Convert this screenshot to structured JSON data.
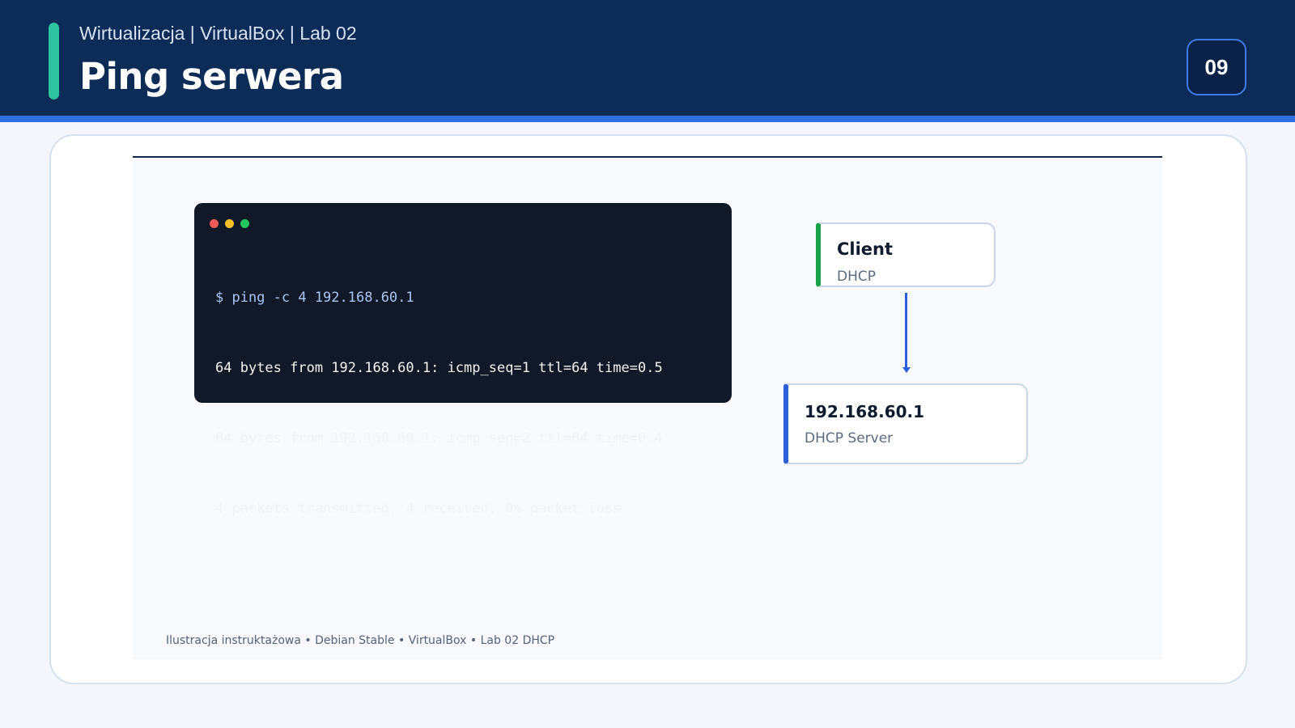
{
  "header": {
    "subtitle": "Wirtualizacja | VirtualBox | Lab 02",
    "title": "Ping serwera",
    "page_number": "09"
  },
  "colors": {
    "header_bg": "#0c2b57",
    "accent_stripe": "#2f6fe0",
    "accent_bar": "#2ec4a0",
    "terminal_bg": "#111827",
    "client_accent": "#18a34a",
    "server_accent": "#2a5fd8"
  },
  "terminal": {
    "window_controls": [
      "close-dot",
      "minimize-dot",
      "maximize-dot"
    ],
    "lines": [
      "$ ping -c 4 192.168.60.1",
      "64 bytes from 192.168.60.1: icmp_seq=1 ttl=64 time=0.5",
      "64 bytes from 192.168.60.1: icmp_seq=2 ttl=64 time=0.4",
      "4 packets transmitted, 4 received, 0% packet loss"
    ]
  },
  "diagram": {
    "client": {
      "title": "Client",
      "subtitle": "DHCP"
    },
    "server": {
      "title": "192.168.60.1",
      "subtitle": "DHCP Server"
    }
  },
  "footer": {
    "note": "Ilustracja instruktażowa • Debian Stable • VirtualBox • Lab 02 DHCP"
  }
}
